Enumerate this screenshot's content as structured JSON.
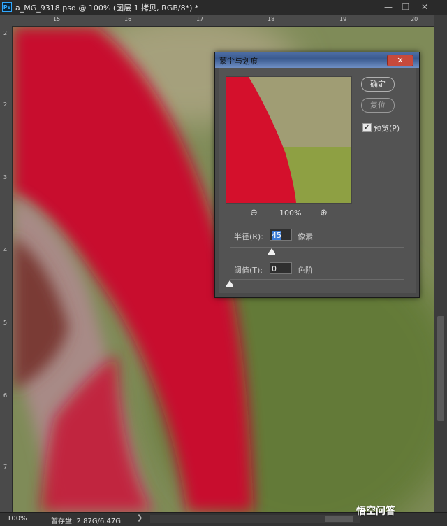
{
  "app": {
    "icon_label": "Ps",
    "doc_title": "a_MG_9318.psd @ 100% (图层 1 拷贝, RGB/8*) *"
  },
  "window_controls": {
    "minimize": "—",
    "restore": "❐",
    "close": "✕"
  },
  "ruler_top_ticks": [
    "15",
    "16",
    "17",
    "18",
    "19",
    "20"
  ],
  "ruler_left_ticks": [
    "2",
    "2",
    "3",
    "4",
    "5",
    "6",
    "7"
  ],
  "status": {
    "zoom": "100%",
    "scratch": "暂存盘: 2.87G/6.47G",
    "arrow": "❯"
  },
  "dialog": {
    "title": "蒙尘与划痕",
    "close_glyph": "✕",
    "ok_label": "确定",
    "reset_label": "复位",
    "preview_checked": true,
    "preview_check_glyph": "✓",
    "preview_label": "预览(P)",
    "zoom_out_icon": "zoom-out-icon",
    "zoom_in_icon": "zoom-in-icon",
    "zoom_out_glyph": "⊖",
    "zoom_in_glyph": "⊕",
    "zoom_level": "100%",
    "radius_label": "半径(R):",
    "radius_value": "45",
    "radius_unit": "像素",
    "radius_slider_fraction": 0.24,
    "threshold_label": "阈值(T):",
    "threshold_value": "0",
    "threshold_unit": "色阶",
    "threshold_slider_fraction": 0.0
  },
  "watermark": "悟空问答",
  "colors": {
    "accent_red": "#c8102e",
    "dialog_bg": "#535353",
    "title_blue": "#3a5a8f"
  }
}
